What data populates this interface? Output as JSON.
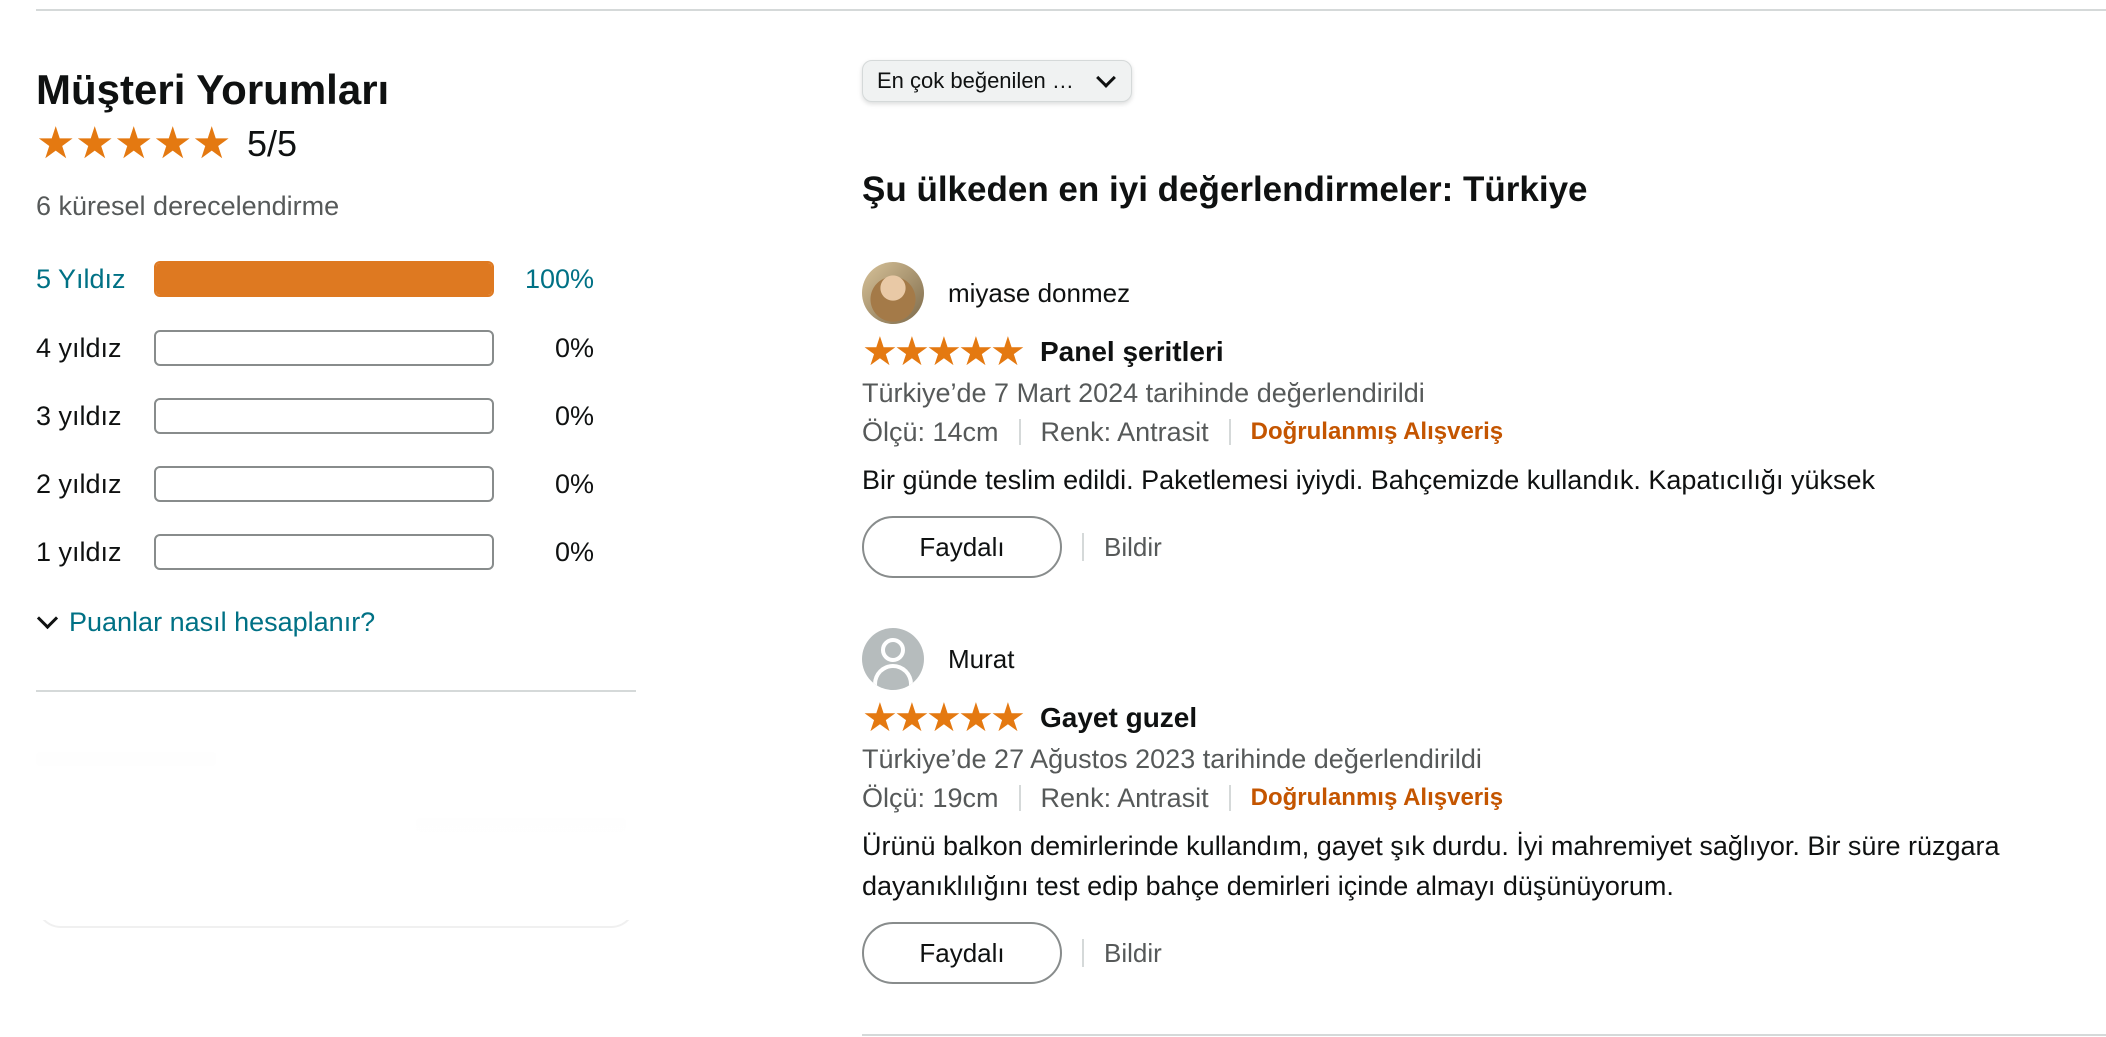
{
  "summary": {
    "title": "Müşteri Yorumları",
    "rating_value": 5,
    "rating_text": "5/5",
    "global_ratings": "6 küresel derecelendirme",
    "histogram": [
      {
        "label": "5 Yıldız",
        "percent": "100%",
        "fraction": 1.0
      },
      {
        "label": "4 yıldız",
        "percent": "0%",
        "fraction": 0
      },
      {
        "label": "3 yıldız",
        "percent": "0%",
        "fraction": 0
      },
      {
        "label": "2 yıldız",
        "percent": "0%",
        "fraction": 0
      },
      {
        "label": "1 yıldız",
        "percent": "0%",
        "fraction": 0
      }
    ],
    "how_calculated_link": "Puanlar nasıl hesaplanır?"
  },
  "sort": {
    "selected": "En çok beğenilen …"
  },
  "reviews_section": {
    "heading": "Şu ülkeden en iyi değerlendirmeler: Türkiye",
    "reviews": [
      {
        "author": "miyase donmez",
        "avatar": "user-photo",
        "rating": 5,
        "title": "Panel şeritleri",
        "date_line": "Türkiye’de 7 Mart 2024 tarihinde değerlendirildi",
        "size": "Ölçü: 14cm",
        "color": "Renk: Antrasit",
        "verified": "Doğrulanmış Alışveriş",
        "body": "Bir günde teslim edildi. Paketlemesi iyiydi. Bahçemizde kullandık. Kapatıcılığı yüksek",
        "helpful_label": "Faydalı",
        "report_label": "Bildir"
      },
      {
        "author": "Murat",
        "avatar": "default-user-icon",
        "rating": 5,
        "title": "Gayet guzel",
        "date_line": "Türkiye’de 27 Ağustos 2023 tarihinde değerlendirildi",
        "size": "Ölçü: 19cm",
        "color": "Renk: Antrasit",
        "verified": "Doğrulanmış Alışveriş",
        "body": "Ürünü balkon demirlerinde kullandım, gayet şık durdu. İyi mahremiyet sağlıyor. Bir süre rüzgara dayanıklılığını test edip bahçe demirleri içinde almayı düşünüyorum.",
        "helpful_label": "Faydalı",
        "report_label": "Bildir"
      }
    ]
  },
  "colors": {
    "star": "#e47911",
    "bar_fill": "#de7921",
    "link": "#007185",
    "verified": "#c45500"
  }
}
